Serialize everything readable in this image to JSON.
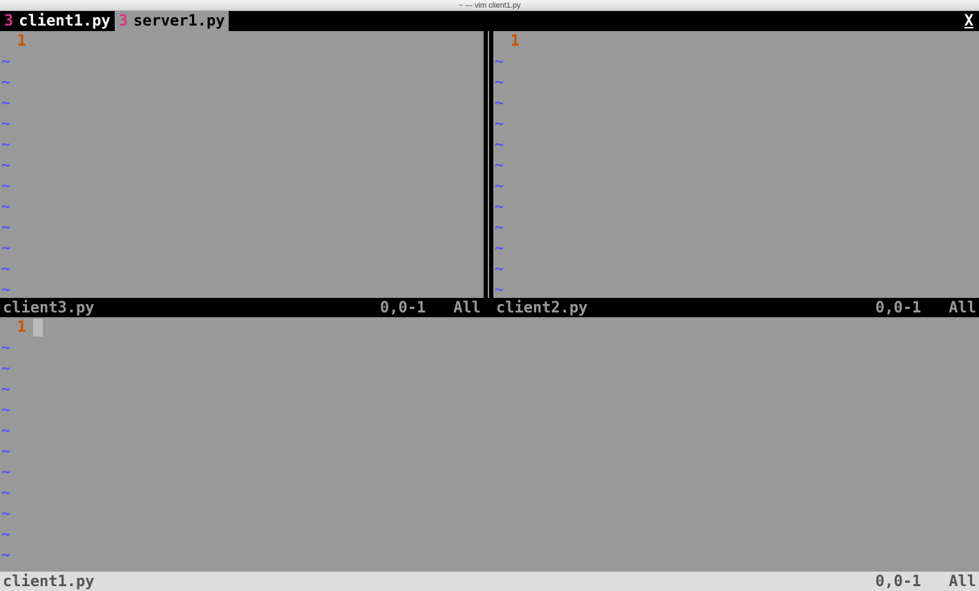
{
  "titlebar": "~ — vim client1.py",
  "tabs": [
    {
      "num": "3",
      "name": "client1.py",
      "active": true
    },
    {
      "num": "3",
      "name": "server1.py",
      "active": false
    }
  ],
  "tab_close": "X",
  "panes": {
    "top_left": {
      "lineno": "1",
      "status": {
        "file": "client3.py",
        "pos": "0,0-1",
        "pct": "All"
      }
    },
    "top_right": {
      "lineno": "1",
      "status": {
        "file": "client2.py",
        "pos": "0,0-1",
        "pct": "All"
      }
    },
    "bottom": {
      "lineno": "1",
      "status": {
        "file": "client1.py",
        "pos": "0,0-1",
        "pct": "All"
      }
    }
  },
  "tilde": "~"
}
